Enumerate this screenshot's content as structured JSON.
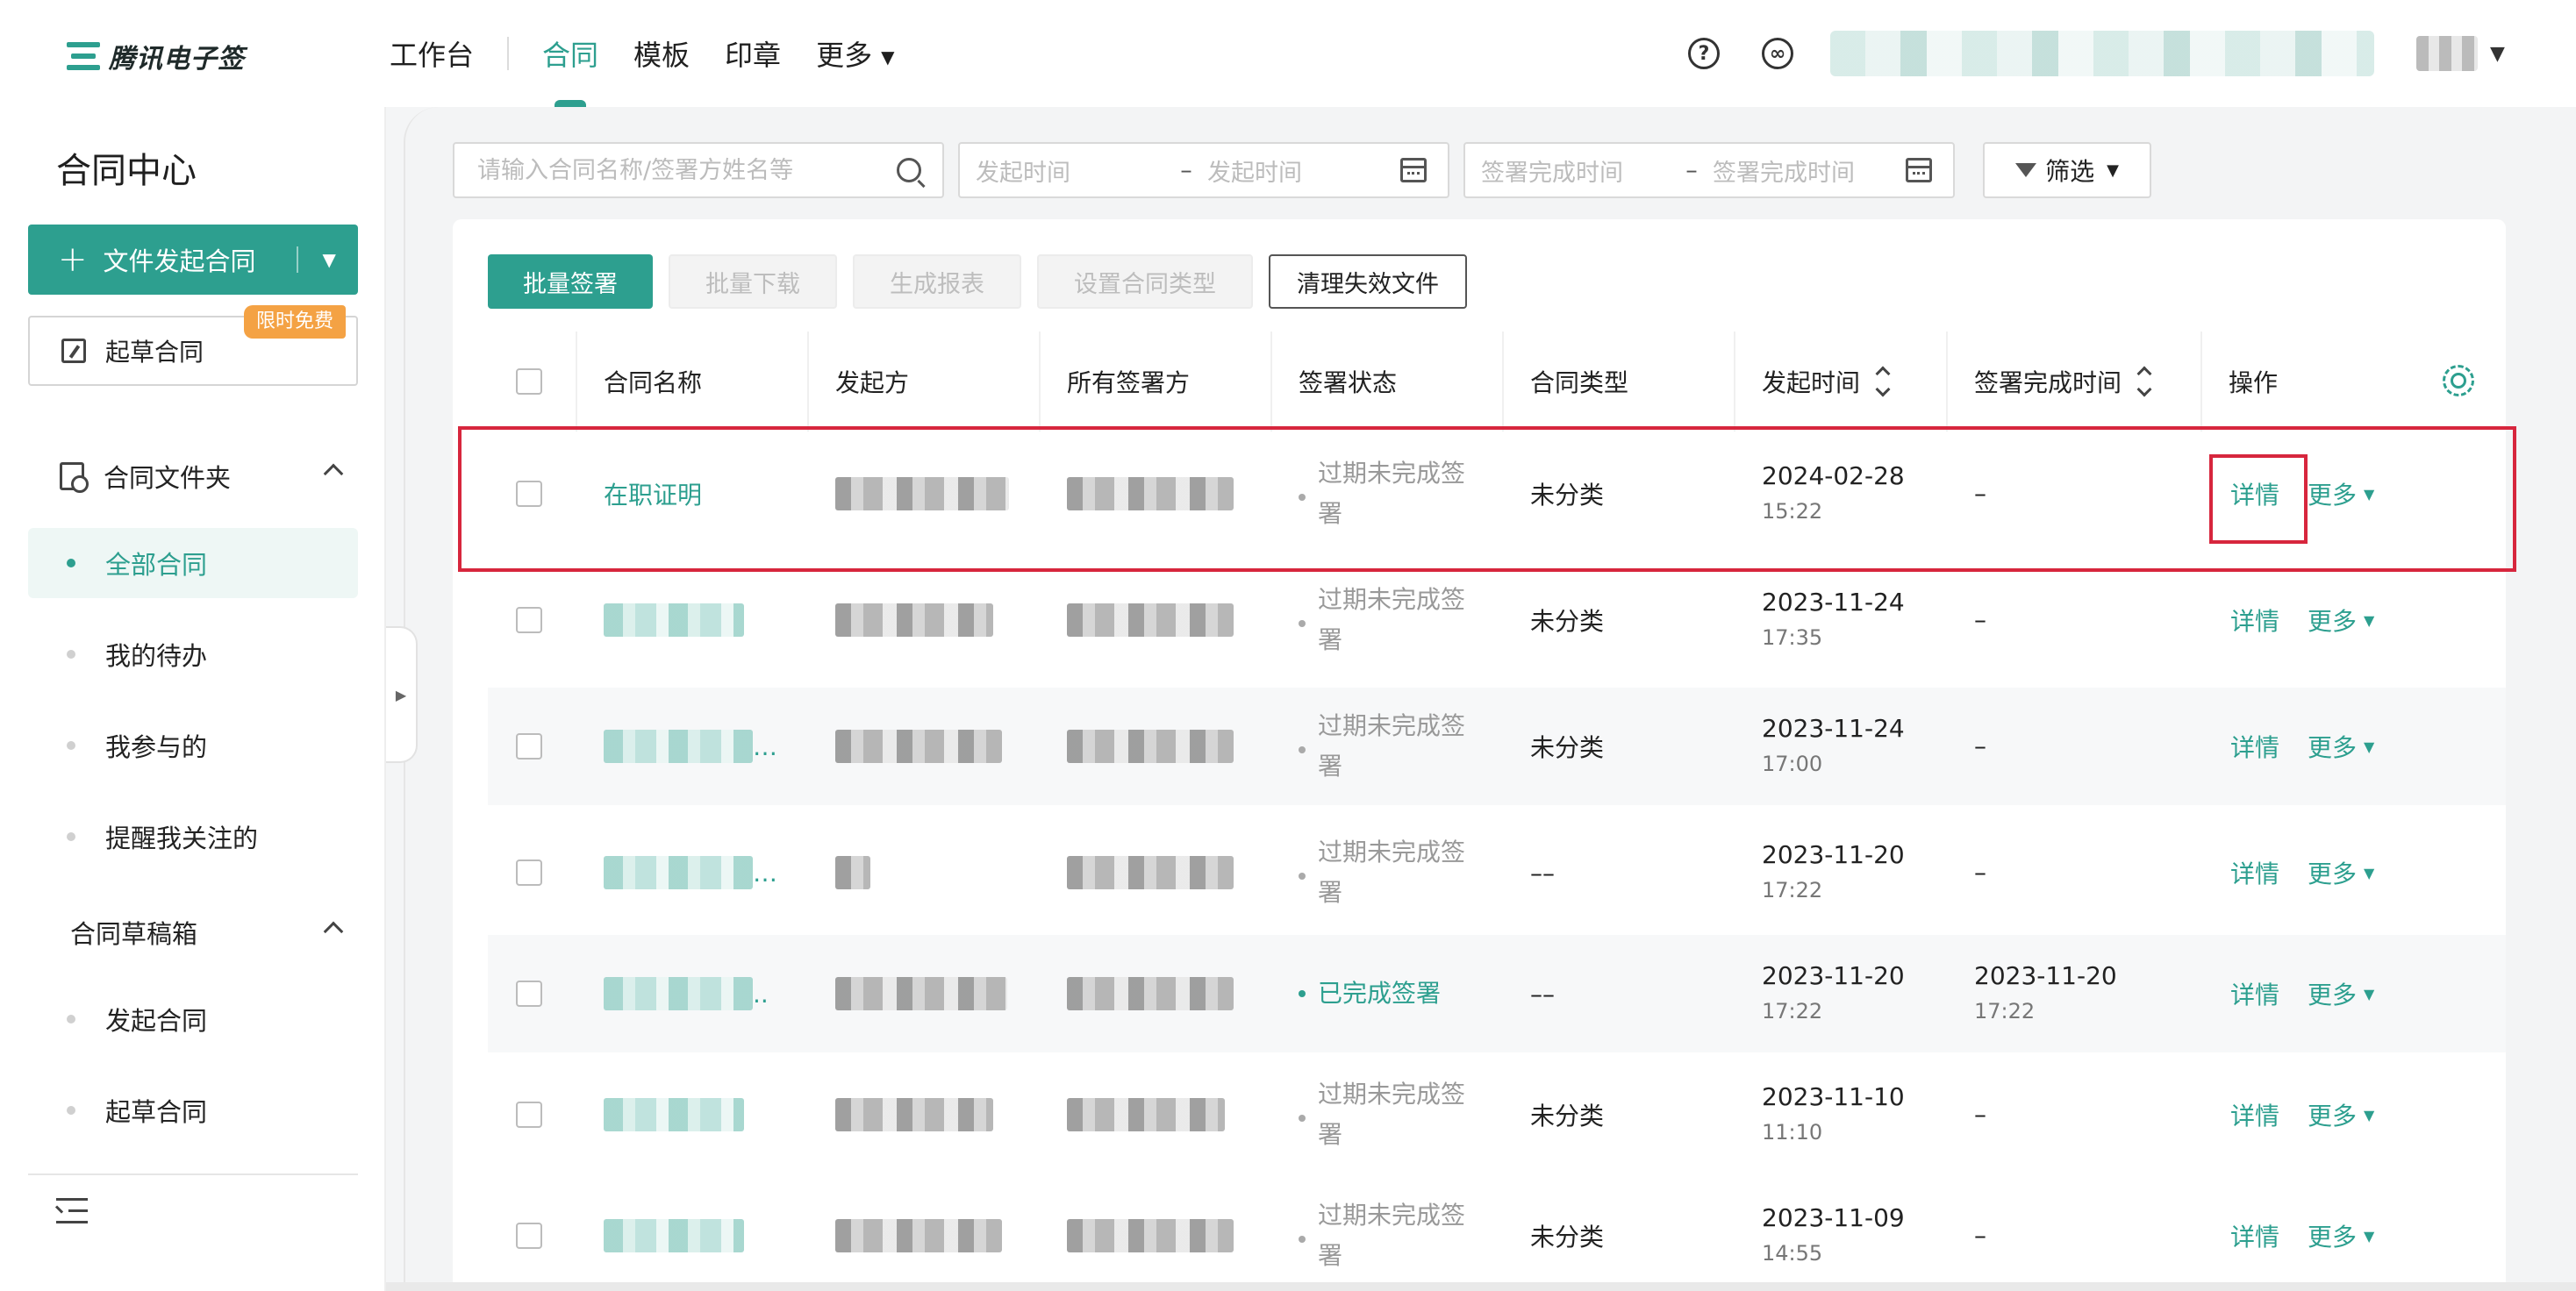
{
  "brand": {
    "name": "腾讯电子签"
  },
  "nav": {
    "workbench": "工作台",
    "items": [
      {
        "label": "合同",
        "active": true
      },
      {
        "label": "模板",
        "active": false
      },
      {
        "label": "印章",
        "active": false
      },
      {
        "label": "更多",
        "active": false,
        "has_dropdown": true
      }
    ],
    "help_icon": "help-circle-icon",
    "link_icon": "link-circle-icon"
  },
  "sidebar": {
    "title": "合同中心",
    "upload_button": "文件发起合同",
    "draft_button": "起草合同",
    "free_badge": "限时免费",
    "folder_section": "合同文件夹",
    "folder_items": [
      {
        "label": "全部合同",
        "active": true
      },
      {
        "label": "我的待办",
        "active": false
      },
      {
        "label": "我参与的",
        "active": false
      },
      {
        "label": "提醒我关注的",
        "active": false
      }
    ],
    "drafts_section": "合同草稿箱",
    "draft_items": [
      {
        "label": "发起合同"
      },
      {
        "label": "起草合同"
      }
    ]
  },
  "filters": {
    "search_placeholder": "请输入合同名称/签署方姓名等",
    "start_time_from": "发起时间",
    "start_time_to": "发起时间",
    "sign_time_from": "签署完成时间",
    "sign_time_to": "签署完成时间",
    "range_dash": "–",
    "filter_button": "筛选"
  },
  "toolbar": {
    "batch_sign": "批量签署",
    "batch_download": "批量下载",
    "generate_report": "生成报表",
    "set_contract_type": "设置合同类型",
    "clean_invalid": "清理失效文件"
  },
  "table": {
    "columns": [
      "合同名称",
      "发起方",
      "所有签署方",
      "签署状态",
      "合同类型",
      "发起时间",
      "签署完成时间",
      "操作"
    ],
    "rows": [
      {
        "name": "在职证明",
        "status": "过期未完成签署",
        "type": "未分类",
        "start_date": "2024-02-28",
        "start_time": "15:22",
        "done_date": "–",
        "done_time": "",
        "detail": "详情",
        "more": "更多"
      },
      {
        "name": "",
        "status": "过期未完成签署",
        "type": "未分类",
        "start_date": "2023-11-24",
        "start_time": "17:35",
        "done_date": "–",
        "done_time": "",
        "detail": "详情",
        "more": "更多"
      },
      {
        "name": "…",
        "status": "过期未完成签署",
        "type": "未分类",
        "start_date": "2023-11-24",
        "start_time": "17:00",
        "done_date": "–",
        "done_time": "",
        "detail": "详情",
        "more": "更多"
      },
      {
        "name": "…",
        "status": "过期未完成签署",
        "type": "––",
        "start_date": "2023-11-20",
        "start_time": "17:22",
        "done_date": "–",
        "done_time": "",
        "detail": "详情",
        "more": "更多"
      },
      {
        "name": "..",
        "status": "已完成签署",
        "type": "––",
        "start_date": "2023-11-20",
        "start_time": "17:22",
        "done_date": "2023-11-20",
        "done_time": "17:22",
        "detail": "详情",
        "more": "更多"
      },
      {
        "name": "",
        "status": "过期未完成签署",
        "type": "未分类",
        "start_date": "2023-11-10",
        "start_time": "11:10",
        "done_date": "–",
        "done_time": "",
        "detail": "详情",
        "more": "更多"
      },
      {
        "name": "",
        "status": "过期未完成签署",
        "type": "未分类",
        "start_date": "2023-11-09",
        "start_time": "14:55",
        "done_date": "–",
        "done_time": "",
        "detail": "详情",
        "more": "更多"
      }
    ]
  },
  "colors": {
    "accent": "#2d9f8f",
    "highlight": "#d7263d",
    "badge": "#f4a244"
  }
}
